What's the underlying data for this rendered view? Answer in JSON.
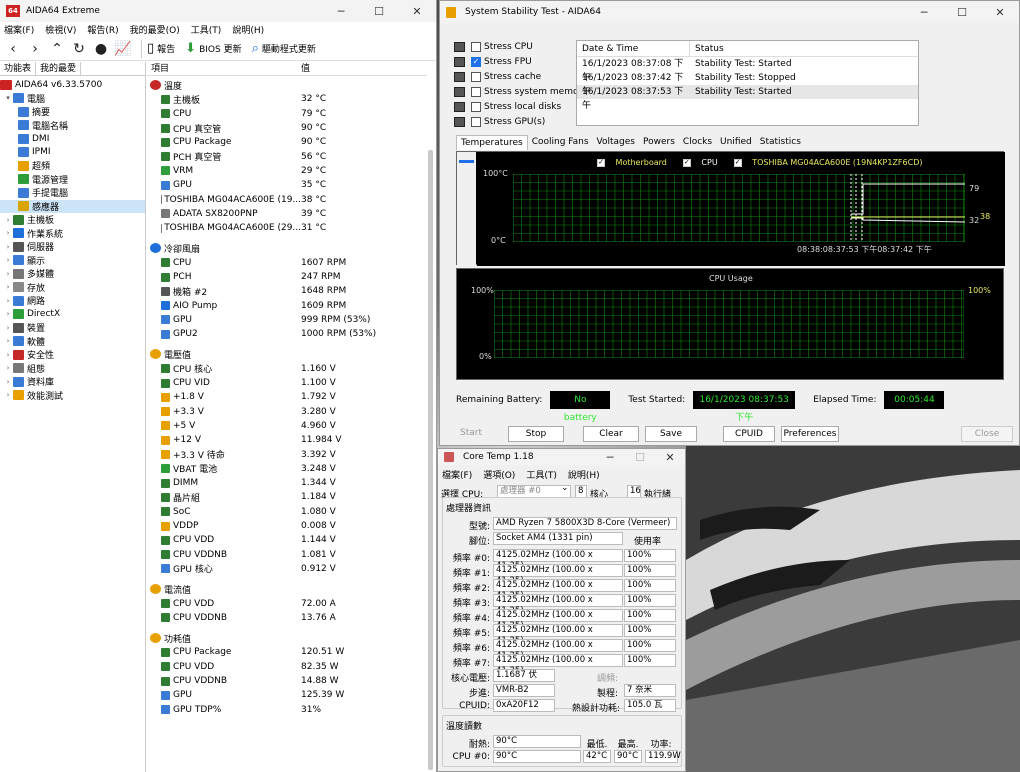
{
  "aida": {
    "title": "AIDA64 Extreme",
    "menu": [
      "檔案(F)",
      "檢視(V)",
      "報告(R)",
      "我的最愛(O)",
      "工具(T)",
      "說明(H)"
    ],
    "toolbar": {
      "report": "報告",
      "bios": "BIOS 更新",
      "driver": "驅動程式更新"
    },
    "left_tabs": [
      "功能表",
      "我的最愛"
    ],
    "version": "AIDA64 v6.33.5700",
    "tree": [
      {
        "label": "電腦",
        "level": 1,
        "expanded": true,
        "color": "#3a7bd5"
      },
      {
        "label": "摘要",
        "level": 2,
        "color": "#3a7bd5"
      },
      {
        "label": "電腦名稱",
        "level": 2,
        "color": "#3a7bd5"
      },
      {
        "label": "DMI",
        "level": 2,
        "color": "#3a7bd5"
      },
      {
        "label": "IPMI",
        "level": 2,
        "color": "#3a7bd5"
      },
      {
        "label": "超頻",
        "level": 2,
        "color": "#e8a000"
      },
      {
        "label": "電源管理",
        "level": 2,
        "color": "#2e9e3b"
      },
      {
        "label": "手提電腦",
        "level": 2,
        "color": "#3a7bd5"
      },
      {
        "label": "感應器",
        "level": 2,
        "color": "#d9a400",
        "selected": true
      },
      {
        "label": "主機板",
        "level": 1,
        "color": "#2e7d32"
      },
      {
        "label": "作業系統",
        "level": 1,
        "color": "#1e6fd9"
      },
      {
        "label": "伺服器",
        "level": 1,
        "color": "#555555"
      },
      {
        "label": "顯示",
        "level": 1,
        "color": "#3a7bd5"
      },
      {
        "label": "多媒體",
        "level": 1,
        "color": "#777777"
      },
      {
        "label": "存放",
        "level": 1,
        "color": "#888888"
      },
      {
        "label": "網路",
        "level": 1,
        "color": "#3a7bd5"
      },
      {
        "label": "DirectX",
        "level": 1,
        "color": "#2e9e3b"
      },
      {
        "label": "裝置",
        "level": 1,
        "color": "#555555"
      },
      {
        "label": "軟體",
        "level": 1,
        "color": "#3a7bd5"
      },
      {
        "label": "安全性",
        "level": 1,
        "color": "#c62828"
      },
      {
        "label": "組態",
        "level": 1,
        "color": "#777777"
      },
      {
        "label": "資料庫",
        "level": 1,
        "color": "#3a7bd5"
      },
      {
        "label": "效能測試",
        "level": 1,
        "color": "#e8a000"
      }
    ],
    "columns": {
      "item": "項目",
      "value": "值"
    },
    "sections": [
      {
        "title": "溫度",
        "color": "#c62828",
        "items": [
          {
            "name": "主機板",
            "value": "32 °C",
            "color": "#2e7d32"
          },
          {
            "name": "CPU",
            "value": "79 °C",
            "color": "#2e7d32"
          },
          {
            "name": "CPU 真空管",
            "value": "90 °C",
            "color": "#2e7d32"
          },
          {
            "name": "CPU Package",
            "value": "90 °C",
            "color": "#2e7d32"
          },
          {
            "name": "PCH 真空管",
            "value": "56 °C",
            "color": "#2e7d32"
          },
          {
            "name": "VRM",
            "value": "29 °C",
            "color": "#2e9e3b"
          },
          {
            "name": "GPU",
            "value": "35 °C",
            "color": "#3a7bd5"
          },
          {
            "name": "TOSHIBA MG04ACA600E (19...",
            "value": "38 °C",
            "color": "#777777"
          },
          {
            "name": "ADATA SX8200PNP",
            "value": "39 °C",
            "color": "#777777"
          },
          {
            "name": "TOSHIBA MG04ACA600E (29...",
            "value": "31 °C",
            "color": "#777777"
          }
        ]
      },
      {
        "title": "冷卻風扇",
        "color": "#1e6fd9",
        "items": [
          {
            "name": "CPU",
            "value": "1607 RPM",
            "color": "#2e7d32"
          },
          {
            "name": "PCH",
            "value": "247 RPM",
            "color": "#2e7d32"
          },
          {
            "name": "機箱 #2",
            "value": "1648 RPM",
            "color": "#555555"
          },
          {
            "name": "AIO Pump",
            "value": "1609 RPM",
            "color": "#1e6fd9"
          },
          {
            "name": "GPU",
            "value": "999 RPM  (53%)",
            "color": "#3a7bd5"
          },
          {
            "name": "GPU2",
            "value": "1000 RPM  (53%)",
            "color": "#3a7bd5"
          }
        ]
      },
      {
        "title": "電壓值",
        "color": "#e8a000",
        "items": [
          {
            "name": "CPU 核心",
            "value": "1.160 V",
            "color": "#2e7d32"
          },
          {
            "name": "CPU VID",
            "value": "1.100 V",
            "color": "#2e7d32"
          },
          {
            "name": "+1.8 V",
            "value": "1.792 V",
            "color": "#e8a000"
          },
          {
            "name": "+3.3 V",
            "value": "3.280 V",
            "color": "#e8a000"
          },
          {
            "name": "+5 V",
            "value": "4.960 V",
            "color": "#e8a000"
          },
          {
            "name": "+12 V",
            "value": "11.984 V",
            "color": "#e8a000"
          },
          {
            "name": "+3.3 V 待命",
            "value": "3.392 V",
            "color": "#e8a000"
          },
          {
            "name": "VBAT 電池",
            "value": "3.248 V",
            "color": "#2e9e3b"
          },
          {
            "name": "DIMM",
            "value": "1.344 V",
            "color": "#2e7d32"
          },
          {
            "name": "晶片組",
            "value": "1.184 V",
            "color": "#2e7d32"
          },
          {
            "name": "SoC",
            "value": "1.080 V",
            "color": "#2e7d32"
          },
          {
            "name": "VDDP",
            "value": "0.008 V",
            "color": "#e8a000"
          },
          {
            "name": "CPU VDD",
            "value": "1.144 V",
            "color": "#2e7d32"
          },
          {
            "name": "CPU VDDNB",
            "value": "1.081 V",
            "color": "#2e7d32"
          },
          {
            "name": "GPU 核心",
            "value": "0.912 V",
            "color": "#3a7bd5"
          }
        ]
      },
      {
        "title": "電流值",
        "color": "#e8a000",
        "items": [
          {
            "name": "CPU VDD",
            "value": "72.00 A",
            "color": "#2e7d32"
          },
          {
            "name": "CPU VDDNB",
            "value": "13.76 A",
            "color": "#2e7d32"
          }
        ]
      },
      {
        "title": "功耗值",
        "color": "#e8a000",
        "items": [
          {
            "name": "CPU Package",
            "value": "120.51 W",
            "color": "#2e7d32"
          },
          {
            "name": "CPU VDD",
            "value": "82.35 W",
            "color": "#2e7d32"
          },
          {
            "name": "CPU VDDNB",
            "value": "14.88 W",
            "color": "#2e7d32"
          },
          {
            "name": "GPU",
            "value": "125.39 W",
            "color": "#3a7bd5"
          },
          {
            "name": "GPU TDP%",
            "value": "31%",
            "color": "#3a7bd5"
          }
        ]
      }
    ]
  },
  "sst": {
    "title": "System Stability Test - AIDA64",
    "stress": [
      {
        "label": "Stress CPU",
        "checked": false
      },
      {
        "label": "Stress FPU",
        "checked": true
      },
      {
        "label": "Stress cache",
        "checked": false
      },
      {
        "label": "Stress system memory",
        "checked": false
      },
      {
        "label": "Stress local disks",
        "checked": false
      },
      {
        "label": "Stress GPU(s)",
        "checked": false
      }
    ],
    "log_headers": [
      "Date & Time",
      "Status"
    ],
    "log": [
      {
        "time": "16/1/2023 08:37:08 下午",
        "status": "Stability Test: Started"
      },
      {
        "time": "16/1/2023 08:37:42 下午",
        "status": "Stability Test: Stopped"
      },
      {
        "time": "16/1/2023 08:37:53 下午",
        "status": "Stability Test: Started"
      }
    ],
    "tabs": [
      "Temperatures",
      "Cooling Fans",
      "Voltages",
      "Powers",
      "Clocks",
      "Unified",
      "Statistics"
    ],
    "legend": [
      "Motherboard",
      "CPU",
      "TOSHIBA MG04ACA600E (19N4KP1ZF6CD)"
    ],
    "temp_graph": {
      "ymax": "100°C",
      "ymin": "0°C",
      "time_labels": "08:38:08:37:53 下午08:37:42 下午",
      "v1": "79",
      "v2": "32",
      "v3": "38"
    },
    "cpu_graph": {
      "title": "CPU Usage",
      "ymax": "100%",
      "ymin": "0%",
      "right": "100%"
    },
    "remaining_battery_label": "Remaining Battery:",
    "remaining_battery": "No battery",
    "test_started_label": "Test Started:",
    "test_started": "16/1/2023 08:37:53 下午",
    "elapsed_label": "Elapsed Time:",
    "elapsed": "00:05:44",
    "buttons": [
      "Start",
      "Stop",
      "Clear",
      "Save",
      "CPUID",
      "Preferences",
      "Close"
    ]
  },
  "coretemp": {
    "title": "Core Temp 1.18",
    "menu": [
      "檔案(F)",
      "選項(O)",
      "工具(T)",
      "說明(H)"
    ],
    "select_cpu_label": "選擇 CPU:",
    "processor": "處理器 #0",
    "cores": "8",
    "cores_label": "核心",
    "threads": "16",
    "threads_label": "執行緒",
    "info_label": "處理器資訊",
    "model_label": "型號:",
    "model": "AMD Ryzen 7 5800X3D 8-Core (Vermeer)",
    "socket_label": "腳位:",
    "socket": "Socket AM4 (1331 pin)",
    "usage_label": "使用率",
    "freqs": [
      {
        "label": "頻率 #0:",
        "value": "4125.02MHz (100.00 x 41.25)",
        "load": "100%"
      },
      {
        "label": "頻率 #1:",
        "value": "4125.02MHz (100.00 x 41.25)",
        "load": "100%"
      },
      {
        "label": "頻率 #2:",
        "value": "4125.02MHz (100.00 x 41.25)",
        "load": "100%"
      },
      {
        "label": "頻率 #3:",
        "value": "4125.02MHz (100.00 x 41.25)",
        "load": "100%"
      },
      {
        "label": "頻率 #4:",
        "value": "4125.02MHz (100.00 x 41.25)",
        "load": "100%"
      },
      {
        "label": "頻率 #5:",
        "value": "4125.02MHz (100.00 x 41.25)",
        "load": "100%"
      },
      {
        "label": "頻率 #6:",
        "value": "4125.02MHz (100.00 x 41.25)",
        "load": "100%"
      },
      {
        "label": "頻率 #7:",
        "value": "4125.02MHz (100.00 x 41.25)",
        "load": "100%"
      }
    ],
    "vcore_label": "核心電壓:",
    "vcore": "1.1687 伏",
    "mod_label": "調頻:",
    "step_label": "步進:",
    "step": "VMR-B2",
    "process_label": "製程:",
    "process": "7 奈米",
    "cpuid_label": "CPUID:",
    "cpuid": "0xA20F12",
    "tdp_label": "熱設計功耗:",
    "tdp": "105.0 瓦",
    "temp_label": "溫度讀數",
    "tj_label": "耐熱:",
    "tj": "90°C",
    "min_label": "最低.",
    "max_label": "最高.",
    "power_label": "功率:",
    "cpu0_label": "CPU #0:",
    "cpu0": "90°C",
    "min": "42°C",
    "max": "90°C",
    "power": "119.9W"
  }
}
